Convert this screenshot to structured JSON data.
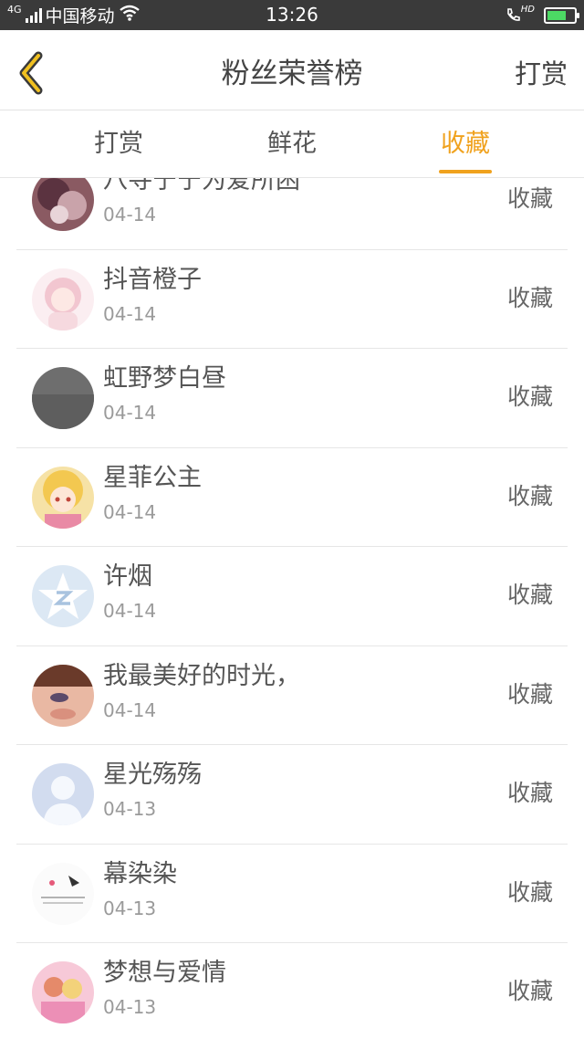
{
  "status_bar": {
    "network_type": "4G",
    "carrier": "中国移动",
    "time": "13:26",
    "hd_label": "HD",
    "battery_level": 0.7
  },
  "header": {
    "title": "粉丝荣誉榜",
    "back_icon": "chevron-left-icon",
    "right_action": "打赏"
  },
  "colors": {
    "accent": "#f0a21e",
    "status_bar_bg": "#3a3a3a",
    "text_primary": "#555555",
    "text_secondary": "#9a9a9a"
  },
  "tabs": [
    {
      "label": "打赏",
      "active": false
    },
    {
      "label": "鲜花",
      "active": false
    },
    {
      "label": "收藏",
      "active": true
    }
  ],
  "fans": [
    {
      "name": "八寻宁宁为爱所困",
      "date": "04-14",
      "action": "收藏"
    },
    {
      "name": "抖音橙子",
      "date": "04-14",
      "action": "收藏"
    },
    {
      "name": "虹野梦白昼",
      "date": "04-14",
      "action": "收藏"
    },
    {
      "name": "星菲公主",
      "date": "04-14",
      "action": "收藏"
    },
    {
      "name": "许烟",
      "date": "04-14",
      "action": "收藏"
    },
    {
      "name": "我最美好的时光，",
      "date": "04-14",
      "action": "收藏"
    },
    {
      "name": "星光殇殇",
      "date": "04-13",
      "action": "收藏"
    },
    {
      "name": "幕染染",
      "date": "04-13",
      "action": "收藏"
    },
    {
      "name": "梦想与爱情",
      "date": "04-13",
      "action": "收藏"
    }
  ]
}
